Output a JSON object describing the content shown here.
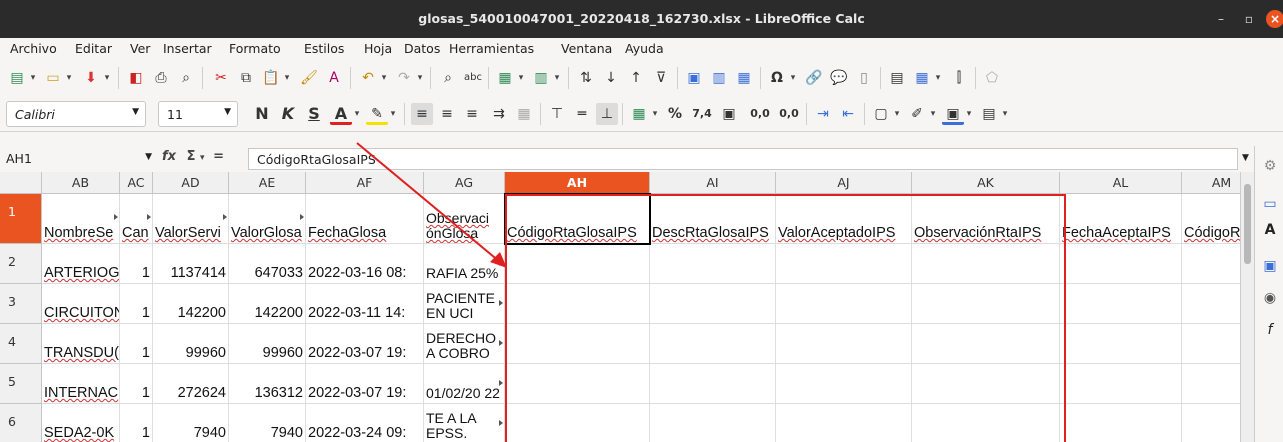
{
  "window": {
    "title": "glosas_540010047001_20220418_162730.xlsx - LibreOffice Calc",
    "minimize": "–",
    "maximize": "▫",
    "close": "×"
  },
  "menu": [
    "Archivo",
    "Editar",
    "Ver",
    "Insertar",
    "Formato",
    "Estilos",
    "Hoja",
    "Datos",
    "Herramientas",
    "Ventana",
    "Ayuda"
  ],
  "formatting": {
    "font_name": "Calibri",
    "font_size": "11",
    "bold": "N",
    "italic": "K",
    "underline": "S",
    "font_color": "A",
    "percent": "%",
    "decimal_format": "7,4",
    "add_decimal": "0,0",
    "del_decimal": "0,0"
  },
  "formula_bar": {
    "name_box": "AH1",
    "fx": "fx",
    "sigma": "Σ",
    "equals": "=",
    "content": "CódigoRtaGlosaIPS"
  },
  "columns": [
    "AB",
    "AC",
    "AD",
    "AE",
    "AF",
    "AG",
    "AH",
    "AI",
    "AJ",
    "AK",
    "AL",
    "AM"
  ],
  "selected_column": "AH",
  "rows": [
    "1",
    "2",
    "3",
    "4",
    "5",
    "6"
  ],
  "header_row": {
    "AB": "NombreSe",
    "AC": "Can",
    "AD": "ValorServi",
    "AE": "ValorGlosa",
    "AF": "FechaGlosa",
    "AG": "Observaci ónGlosa",
    "AH": "CódigoRtaGlosaIPS",
    "AI": "DescRtaGlosaIPS",
    "AJ": "ValorAceptadoIPS",
    "AK": "ObservaciónRtaIPS",
    "AL": "FechaAceptaIPS",
    "AM": "CódigoR"
  },
  "data_rows": [
    {
      "AB": "ARTERIOG",
      "AC": "1",
      "AD": "1137414",
      "AE": "647033",
      "AF": "2022-03-16 08:",
      "AG": "RAFIA 25%"
    },
    {
      "AB": "CIRCUITON",
      "AC": "1",
      "AD": "142200",
      "AE": "142200",
      "AF": "2022-03-11 14:",
      "AG": "PACIENTE EN UCI"
    },
    {
      "AB": "TRANSDU(",
      "AC": "1",
      "AD": "99960",
      "AE": "99960",
      "AF": "2022-03-07 19:",
      "AG": "DERECHO A COBRO"
    },
    {
      "AB": "INTERNAC",
      "AC": "1",
      "AD": "272624",
      "AE": "136312",
      "AF": "2022-03-07 19:",
      "AG": "01/02/20 22"
    },
    {
      "AB": "SEDA2-0K",
      "AC": "1",
      "AD": "7940",
      "AE": "7940",
      "AF": "2022-03-24 09:",
      "AG": "TE A LA EPSS."
    }
  ],
  "colors": {
    "accent": "#e95420",
    "annotation": "#e02020",
    "titlebar": "#2b2b2b"
  }
}
